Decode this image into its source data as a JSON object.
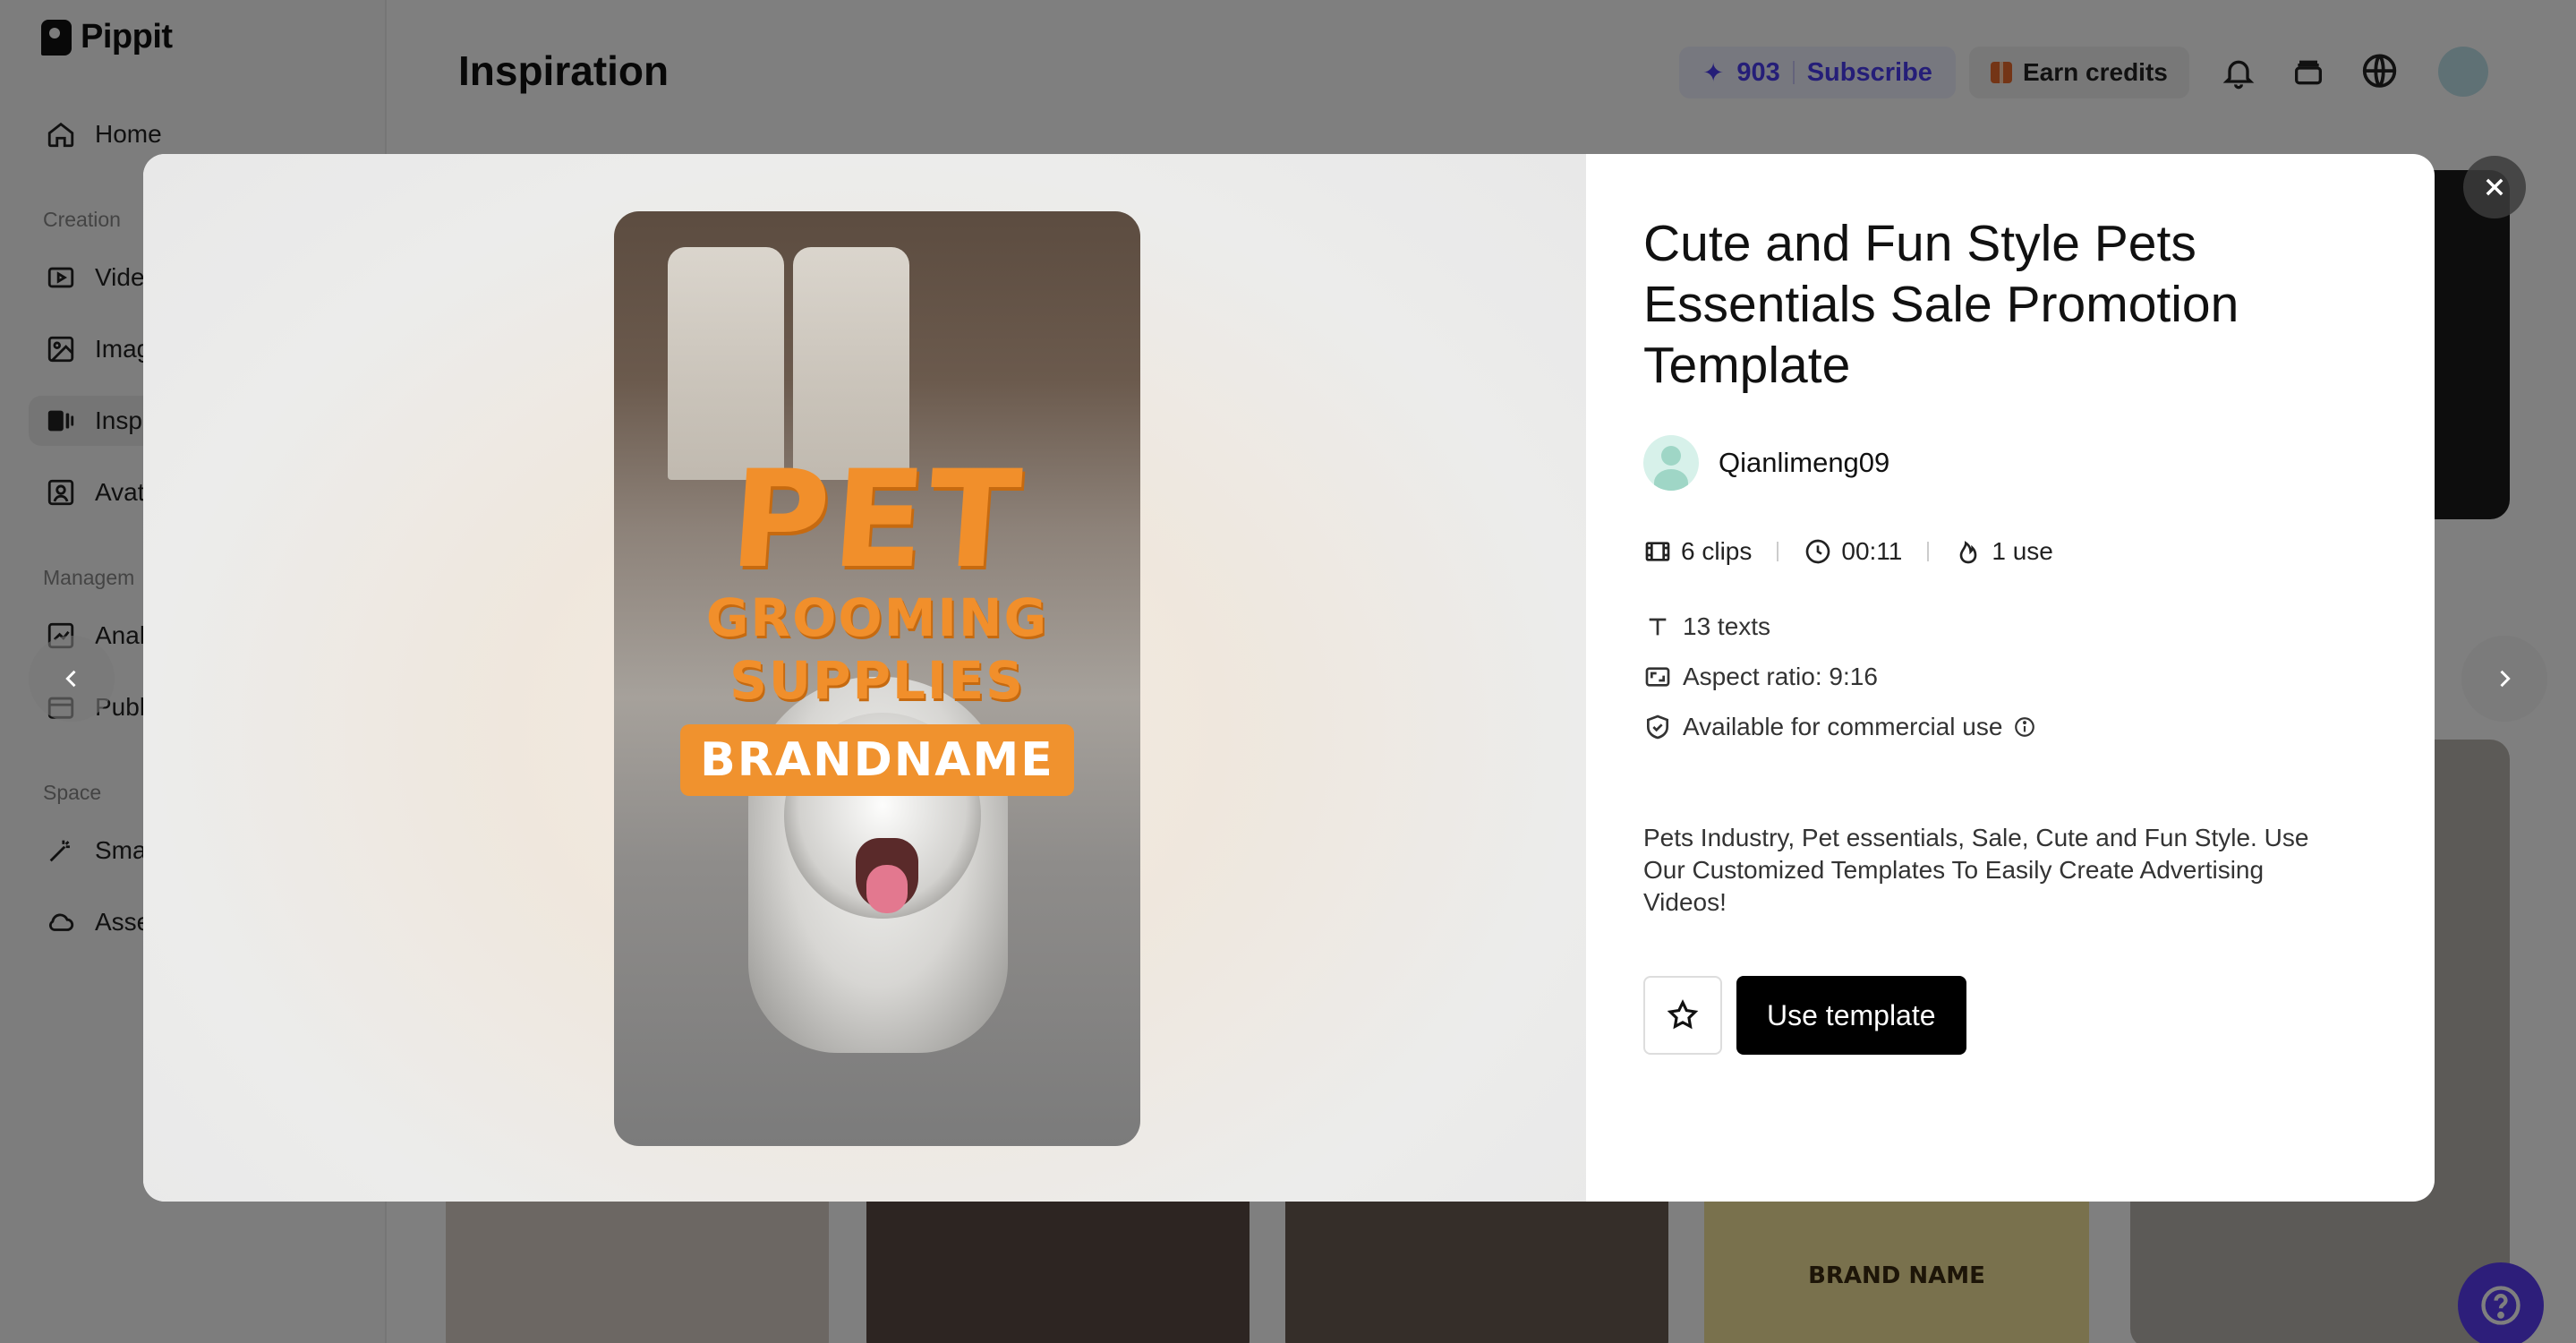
{
  "app": {
    "logo_text": "Pippit",
    "page_title": "Inspiration"
  },
  "sidebar": {
    "items": [
      {
        "label": "Home",
        "icon": "home-icon"
      },
      {
        "label": "Vide",
        "icon": "video-icon"
      },
      {
        "label": "Imag",
        "icon": "image-icon"
      },
      {
        "label": "Insp",
        "icon": "inspiration-icon"
      },
      {
        "label": "Avat",
        "icon": "avatar-icon"
      },
      {
        "label": "Anal",
        "icon": "analytics-icon"
      },
      {
        "label": "Publ",
        "icon": "publish-icon"
      },
      {
        "label": "Sma",
        "icon": "smart-tool-icon"
      },
      {
        "label": "Asse",
        "icon": "assets-icon"
      }
    ],
    "sections": [
      "Creation",
      "Managem",
      "Space"
    ]
  },
  "header": {
    "credits_value": "903",
    "subscribe_label": "Subscribe",
    "earn_label": "Earn credits",
    "language": "EN"
  },
  "modal": {
    "promo": {
      "line1": "PET",
      "line2": "GROOMING",
      "line3": "SUPPLIES",
      "brand": "BRANDNAME"
    },
    "title": "Cute and Fun Style Pets Essentials Sale Promotion Template",
    "author": "Qianlimeng09",
    "stats": {
      "clips": "6 clips",
      "duration": "00:11",
      "uses": "1 use"
    },
    "meta": {
      "texts": "13 texts",
      "aspect": "Aspect ratio: 9:16",
      "commercial": "Available for commercial use"
    },
    "description": "Pets Industry, Pet essentials, Sale, Cute and Fun Style. Use Our Customized Templates To Easily Create Advertising Videos!",
    "use_template_label": "Use template"
  },
  "background_card_text": "BRAND NAME",
  "colors": {
    "accent": "#5b3df5",
    "credits_text": "#4b3df0",
    "promo_orange": "#f18f2b",
    "button_black": "#000000"
  }
}
